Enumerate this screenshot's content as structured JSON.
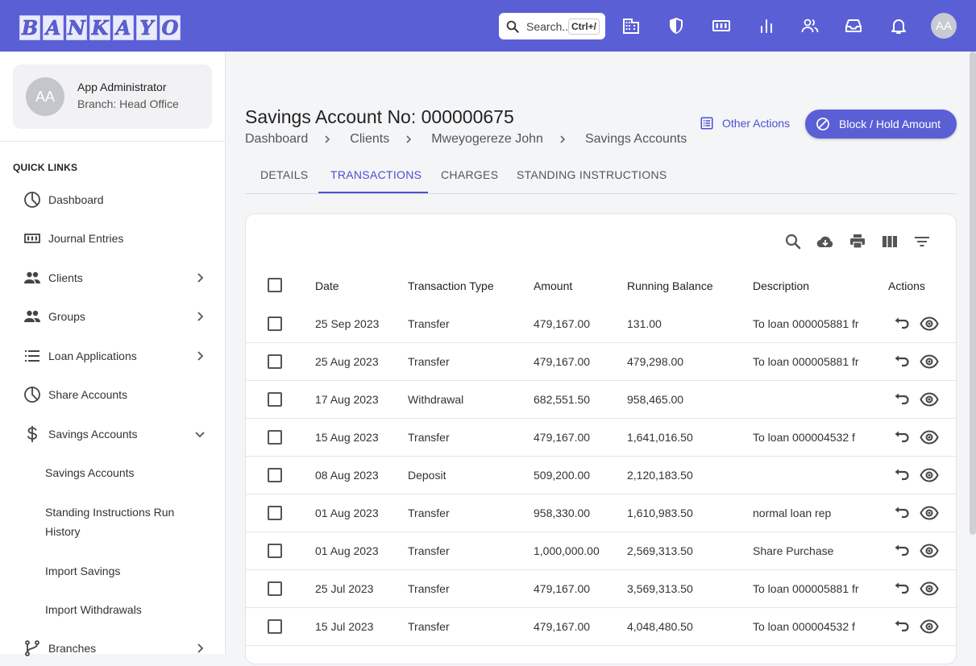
{
  "brand": {
    "logo_letters": [
      "B",
      "A",
      "N",
      "K",
      "A",
      "Y",
      "O"
    ],
    "accent": "#5b5fd6"
  },
  "topbar": {
    "search_placeholder": "Search..",
    "search_shortcut": "Ctrl+/",
    "icons": [
      "building-icon",
      "shield-icon",
      "journal-icon",
      "chart-icon",
      "users-icon",
      "inbox-icon",
      "bell-icon"
    ],
    "avatar": "AA"
  },
  "profile": {
    "avatar": "AA",
    "name": "App Administrator",
    "branch": "Branch: Head Office"
  },
  "sidebar": {
    "section_title": "QUICK LINKS",
    "items": [
      {
        "label": "Dashboard",
        "icon": "pie-chart-icon"
      },
      {
        "label": "Journal Entries",
        "icon": "journal-icon"
      },
      {
        "label": "Clients",
        "icon": "people-icon",
        "expandable": true
      },
      {
        "label": "Groups",
        "icon": "people-icon",
        "expandable": true
      },
      {
        "label": "Loan Applications",
        "icon": "list-icon",
        "expandable": true
      },
      {
        "label": "Share Accounts",
        "icon": "pie-chart-icon"
      },
      {
        "label": "Savings Accounts",
        "icon": "dollar-icon",
        "expanded": true
      },
      {
        "label": "Branches",
        "icon": "branch-icon",
        "expandable": true
      }
    ],
    "sub_items": [
      "Savings Accounts",
      "Standing Instructions Run History",
      "Import Savings",
      "Import Withdrawals"
    ]
  },
  "page": {
    "title": "Savings Account No: 000000675",
    "breadcrumb": [
      "Dashboard",
      "Clients",
      "Mweyogereze John",
      "Savings Accounts"
    ],
    "other_actions": "Other Actions",
    "block_button": "Block / Hold Amount",
    "tabs": [
      "DETAILS",
      "TRANSACTIONS",
      "CHARGES",
      "STANDING INSTRUCTIONS"
    ],
    "active_tab": "TRANSACTIONS"
  },
  "table": {
    "columns": [
      "Date",
      "Transaction Type",
      "Amount",
      "Running Balance",
      "Description",
      "Actions"
    ],
    "rows": [
      {
        "date": "25 Sep 2023",
        "type": "Transfer",
        "amount": "479,167.00",
        "balance": "131.00",
        "description": "To loan 000005881 fr"
      },
      {
        "date": "25 Aug 2023",
        "type": "Transfer",
        "amount": "479,167.00",
        "balance": "479,298.00",
        "description": "To loan 000005881 fr"
      },
      {
        "date": "17 Aug 2023",
        "type": "Withdrawal",
        "amount": "682,551.50",
        "balance": "958,465.00",
        "description": ""
      },
      {
        "date": "15 Aug 2023",
        "type": "Transfer",
        "amount": "479,167.00",
        "balance": "1,641,016.50",
        "description": "To loan 000004532 f"
      },
      {
        "date": "08 Aug 2023",
        "type": "Deposit",
        "amount": "509,200.00",
        "balance": "2,120,183.50",
        "description": ""
      },
      {
        "date": "01 Aug 2023",
        "type": "Transfer",
        "amount": "958,330.00",
        "balance": "1,610,983.50",
        "description": "normal loan rep"
      },
      {
        "date": "01 Aug 2023",
        "type": "Transfer",
        "amount": "1,000,000.00",
        "balance": "2,569,313.50",
        "description": "Share Purchase"
      },
      {
        "date": "25 Jul 2023",
        "type": "Transfer",
        "amount": "479,167.00",
        "balance": "3,569,313.50",
        "description": "To loan 000005881 fr"
      },
      {
        "date": "15 Jul 2023",
        "type": "Transfer",
        "amount": "479,167.00",
        "balance": "4,048,480.50",
        "description": "To loan 000004532 f"
      }
    ],
    "toolbar_icons": [
      "search-icon",
      "download-icon",
      "print-icon",
      "columns-icon",
      "filter-icon"
    ]
  }
}
